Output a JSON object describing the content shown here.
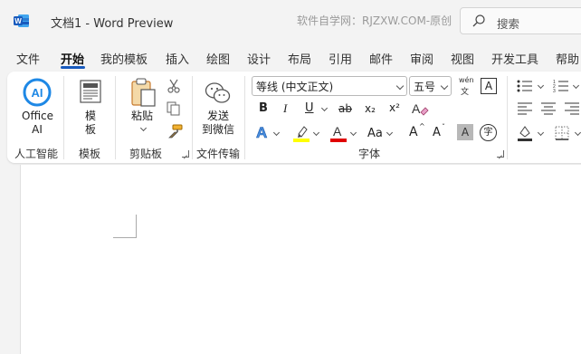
{
  "window": {
    "doc_title": "文档1  -  Word Preview",
    "watermark": "软件自学网：RJZXW.COM-原创",
    "search_placeholder": "搜索"
  },
  "tabs": [
    "文件",
    "开始",
    "我的模板",
    "插入",
    "绘图",
    "设计",
    "布局",
    "引用",
    "邮件",
    "审阅",
    "视图",
    "开发工具",
    "帮助"
  ],
  "active_tab": "开始",
  "ribbon": {
    "ai_group": {
      "button_line1": "Office",
      "button_line2": "AI",
      "label": "人工智能"
    },
    "template_group": {
      "button_line1": "模",
      "button_line2": "板",
      "label": "模板"
    },
    "clipboard_group": {
      "paste_label": "粘贴",
      "label": "剪贴板"
    },
    "transfer_group": {
      "button_line1": "发送",
      "button_line2": "到微信",
      "label": "文件传输"
    },
    "font_group": {
      "font_name": "等线 (中文正文)",
      "font_size": "五号",
      "phonetic_top": "wén",
      "phonetic_bottom": "文",
      "border_char": "A",
      "bold": "B",
      "italic": "I",
      "underline": "U",
      "strike": "ab",
      "subscript": "x₂",
      "superscript": "x²",
      "case_label": "Aa",
      "grow": "A",
      "shrink": "A",
      "shading_char": "A",
      "enclose_char": "字",
      "label": "字体"
    }
  },
  "colors": {
    "accent": "#185abd",
    "highlight": "#ffff00",
    "font_color": "#e00000",
    "ai_blue": "#1e88e5"
  }
}
